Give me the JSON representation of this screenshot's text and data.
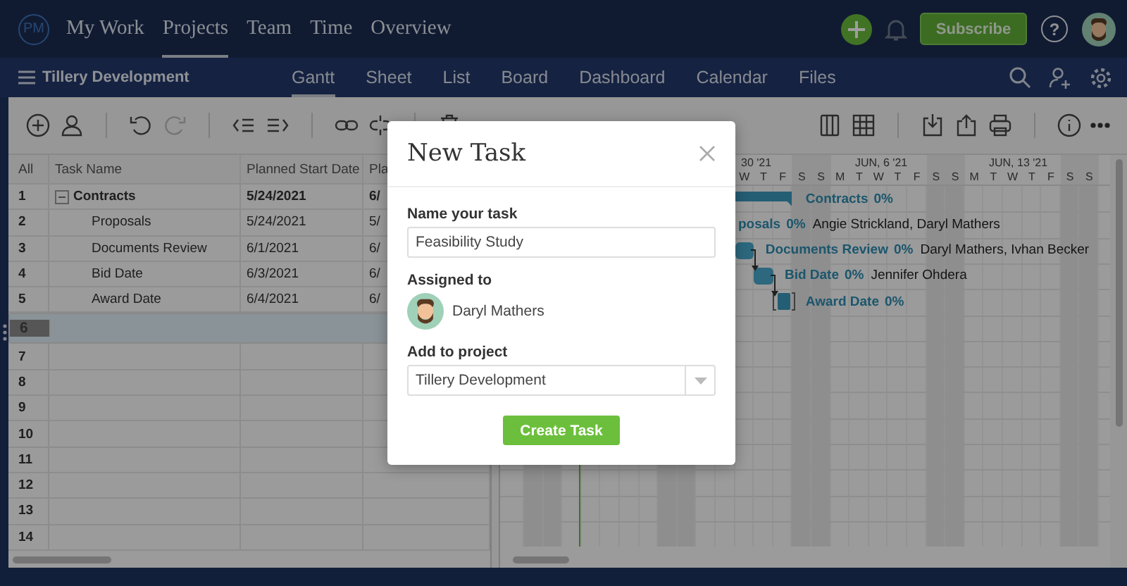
{
  "top_nav": {
    "logo": "PM",
    "items": [
      {
        "label": "My Work",
        "selected": false
      },
      {
        "label": "Projects",
        "selected": true
      },
      {
        "label": "Team",
        "selected": false
      },
      {
        "label": "Time",
        "selected": false
      },
      {
        "label": "Overview",
        "selected": false
      }
    ],
    "subscribe": "Subscribe",
    "help": "?"
  },
  "project_bar": {
    "title": "Tillery Development",
    "tabs": [
      {
        "label": "Gantt",
        "selected": true
      },
      {
        "label": "Sheet",
        "selected": false
      },
      {
        "label": "List",
        "selected": false
      },
      {
        "label": "Board",
        "selected": false
      },
      {
        "label": "Dashboard",
        "selected": false
      },
      {
        "label": "Calendar",
        "selected": false
      },
      {
        "label": "Files",
        "selected": false
      }
    ]
  },
  "table": {
    "columns": [
      "All",
      "Task Name",
      "Planned Start Date",
      "Pla"
    ],
    "rows": [
      {
        "number": "1",
        "name": "Contracts",
        "start": "5/24/2021",
        "column_4": "6/",
        "kind": "group",
        "expanded": true,
        "selected": false
      },
      {
        "number": "2",
        "name": "Proposals",
        "start": "5/24/2021",
        "column_4": "5/",
        "kind": "task",
        "selected": false
      },
      {
        "number": "3",
        "name": "Documents Review",
        "start": "6/1/2021",
        "column_4": "6/",
        "kind": "task",
        "selected": false
      },
      {
        "number": "4",
        "name": "Bid Date",
        "start": "6/3/2021",
        "column_4": "6/",
        "kind": "task",
        "selected": false
      },
      {
        "number": "5",
        "name": "Award Date",
        "start": "6/4/2021",
        "column_4": "6/",
        "kind": "task",
        "selected": false
      },
      {
        "number": "6",
        "selected": true
      },
      {
        "number": "7",
        "selected": false
      },
      {
        "number": "8",
        "selected": false
      },
      {
        "number": "9",
        "selected": false
      },
      {
        "number": "10",
        "selected": false
      },
      {
        "number": "11",
        "selected": false
      },
      {
        "number": "12",
        "selected": false
      },
      {
        "number": "13",
        "selected": false
      },
      {
        "number": "14",
        "selected": false
      }
    ]
  },
  "gantt": {
    "weeks": [
      "30 '21",
      "JUN, 6 '21",
      "JUN, 13 '21"
    ],
    "days": [
      "W",
      "T",
      "F",
      "S",
      "S",
      "M",
      "T",
      "W",
      "T",
      "F",
      "S",
      "S",
      "M",
      "T",
      "W",
      "T",
      "F",
      "S",
      "S"
    ],
    "tasks": [
      {
        "kind": "summary",
        "label": "Contracts",
        "progress": "0%"
      },
      {
        "kind": "task",
        "label": "posals",
        "progress": "0%",
        "assignees": "Angie Strickland, Daryl Mathers"
      },
      {
        "kind": "task",
        "label": "Documents Review",
        "progress": "0%",
        "assignees": "Daryl Mathers, Ivhan Becker"
      },
      {
        "kind": "task",
        "label": "Bid Date",
        "progress": "0%",
        "assignees": "Jennifer Ohdera"
      },
      {
        "kind": "milestone",
        "label": "Award Date",
        "progress": "0%"
      }
    ]
  },
  "modal": {
    "title": "New Task",
    "name_label": "Name your task",
    "name_value": "Feasibility Study",
    "assigned_label": "Assigned to",
    "assignee": "Daryl Mathers",
    "project_label": "Add to project",
    "project_value": "Tillery Development",
    "submit": "Create Task"
  }
}
